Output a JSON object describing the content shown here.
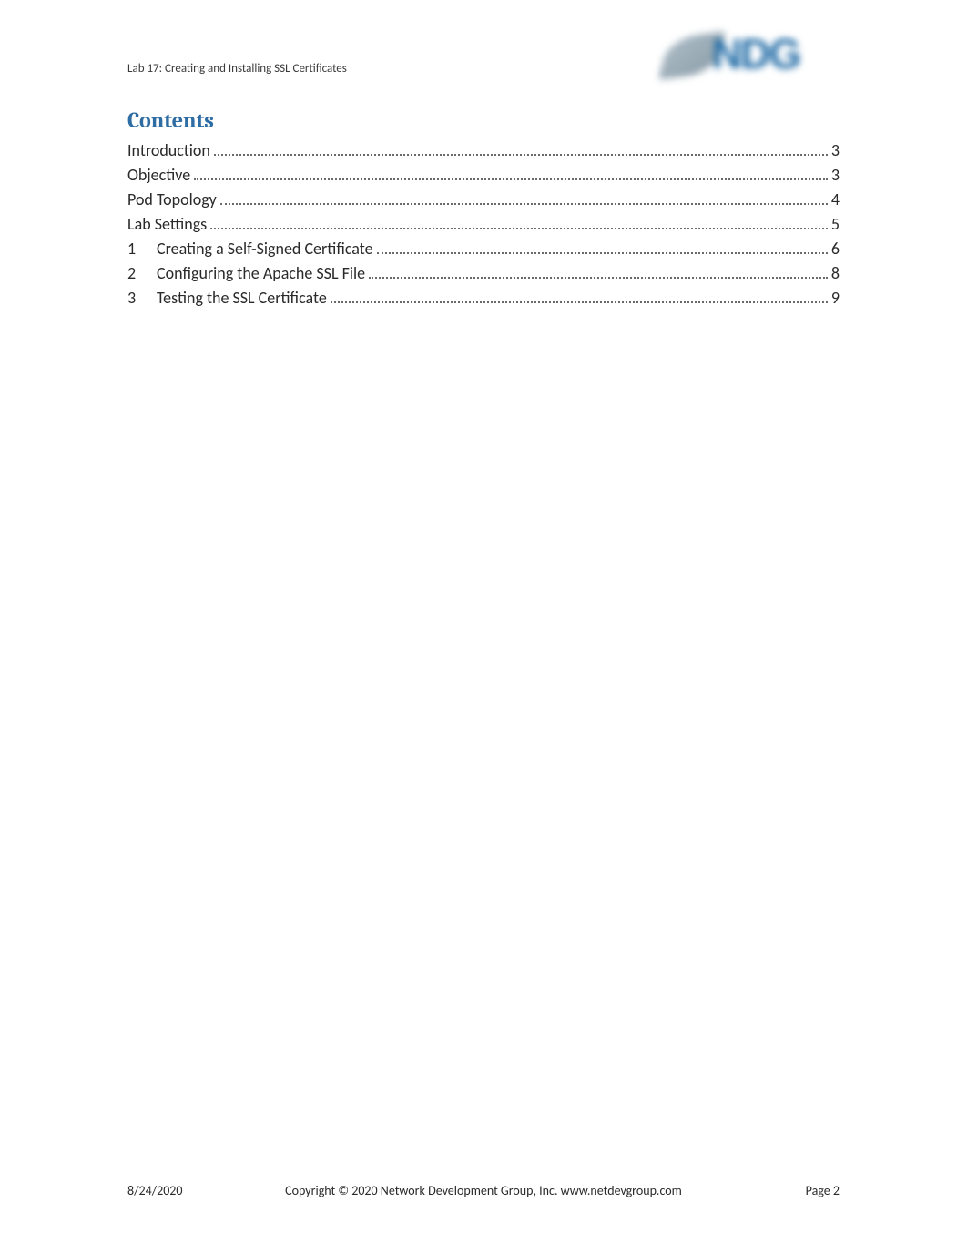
{
  "header": {
    "lab_title": "Lab 17:  Creating and Installing SSL Certificates",
    "logo_text": "NDG"
  },
  "contents": {
    "heading": "Contents",
    "items": [
      {
        "num": "",
        "label": "Introduction",
        "page": "3"
      },
      {
        "num": "",
        "label": "Objective",
        "page": "3"
      },
      {
        "num": "",
        "label": "Pod Topology",
        "page": "4"
      },
      {
        "num": "",
        "label": "Lab Settings",
        "page": "5"
      },
      {
        "num": "1",
        "label": "Creating a Self-Signed Certificate",
        "page": "6"
      },
      {
        "num": "2",
        "label": "Configuring the Apache SSL File",
        "page": "8"
      },
      {
        "num": "3",
        "label": "Testing the SSL Certificate",
        "page": "9"
      }
    ]
  },
  "footer": {
    "date": "8/24/2020",
    "copyright": "Copyright © 2020 Network Development Group, Inc.  www.netdevgroup.com",
    "page_label": "Page 2"
  }
}
